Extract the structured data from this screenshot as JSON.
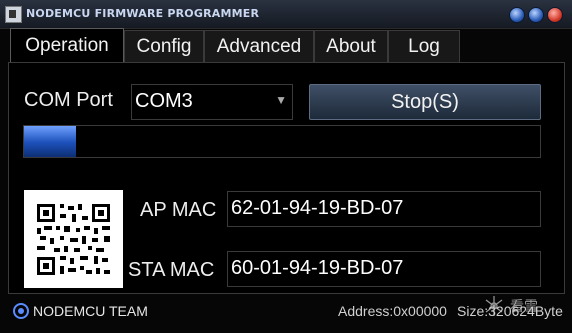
{
  "window": {
    "title": "NODEMCU FIRMWARE PROGRAMMER"
  },
  "tabs": [
    {
      "label": "Operation",
      "active": true
    },
    {
      "label": "Config",
      "active": false
    },
    {
      "label": "Advanced",
      "active": false
    },
    {
      "label": "About",
      "active": false
    },
    {
      "label": "Log",
      "active": false
    }
  ],
  "operation": {
    "com_port_label": "COM Port",
    "com_port_value": "COM3",
    "stop_button_label": "Stop(S)",
    "progress": 0.1,
    "ap_mac_label": "AP MAC",
    "ap_mac_value": "62-01-94-19-BD-07",
    "sta_mac_label": "STA MAC",
    "sta_mac_value": "60-01-94-19-BD-07"
  },
  "footer": {
    "team": "NODEMCU TEAM",
    "address": "Address:0x00000",
    "size": "Size:320624Byte"
  },
  "colors": {
    "accent": "#2f6fe0",
    "background": "#000000",
    "text": "#ffffff"
  },
  "icons": {
    "app": "app-icon",
    "logo": "nodemcu-logo-icon",
    "qr": "qr-code",
    "watermark": "watermark-logo"
  }
}
